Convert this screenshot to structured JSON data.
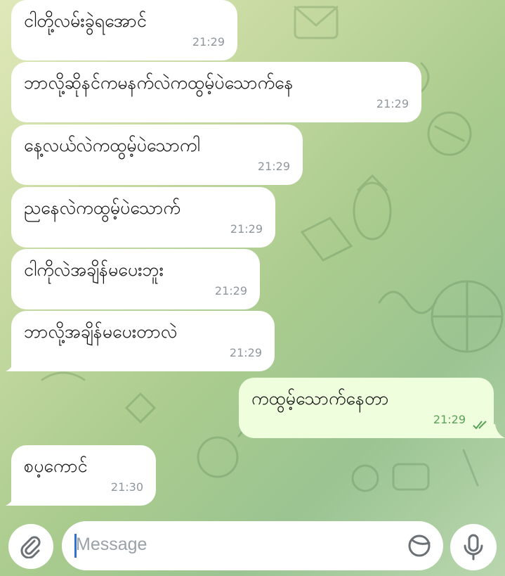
{
  "messages": [
    {
      "text": "ငါတို့လမ်းခွဲရအောင်",
      "time": "21:29",
      "direction": "incoming"
    },
    {
      "text": "ဘာလို့ဆိုနင်ကမနက်လဲကထွမ့်ပဲသောက်နေ",
      "time": "21:29",
      "direction": "incoming"
    },
    {
      "text": "နေ့လယ်လဲကထွမ့်ပဲသောကါ",
      "time": "21:29",
      "direction": "incoming"
    },
    {
      "text": "ညနေလဲကထွမ့်ပဲသောက်",
      "time": "21:29",
      "direction": "incoming"
    },
    {
      "text": "ငါကိုလဲအချိန်မပေးဘူး",
      "time": "21:29",
      "direction": "incoming"
    },
    {
      "text": "ဘာလို့အချိန်မပေးတာလဲ",
      "time": "21:29",
      "direction": "incoming"
    },
    {
      "text": "ကထွမ့်သောက်နေတာ",
      "time": "21:29",
      "direction": "outgoing",
      "status": "read"
    },
    {
      "text": "စပ့ကောင်",
      "time": "21:30",
      "direction": "incoming"
    }
  ],
  "composer": {
    "placeholder": "Message",
    "attach_icon": "paperclip-icon",
    "sticker_icon": "sticker-icon",
    "mic_icon": "microphone-icon"
  },
  "colors": {
    "incoming_bubble": "#ffffff",
    "outgoing_bubble": "#effedd",
    "outgoing_time": "#5aa15a",
    "accent": "#2f6fd6"
  }
}
